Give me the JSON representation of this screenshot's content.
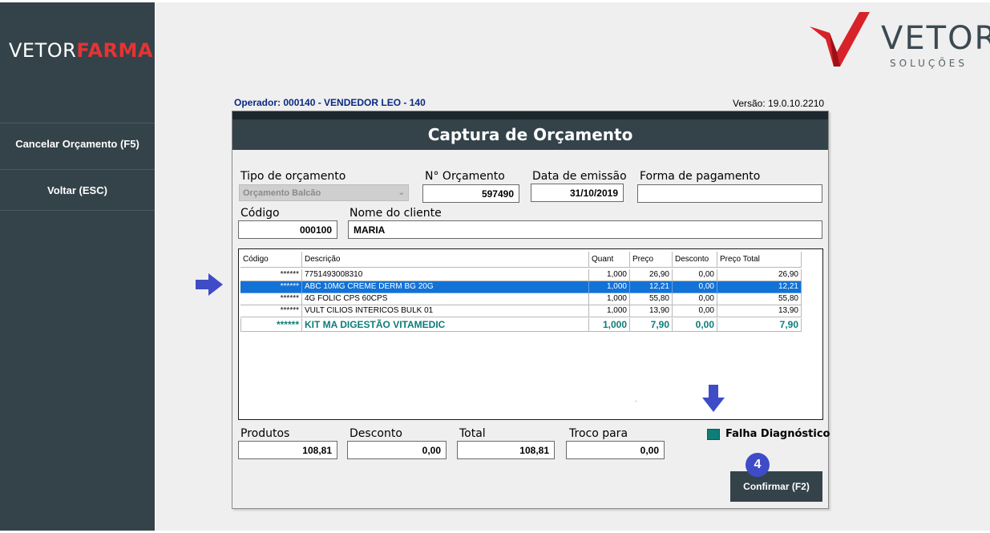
{
  "sidebar": {
    "brand_part1": "VETOR",
    "brand_part2": "FARMA",
    "items": [
      {
        "label": "Cancelar Orçamento (F5)"
      },
      {
        "label": "Voltar (ESC)"
      }
    ]
  },
  "logo": {
    "word": "VETOR",
    "sub": "SOLUÇÕES"
  },
  "header": {
    "operator": "Operador: 000140 - VENDEDOR LEO - 140",
    "version": "Versão: 19.0.10.2210"
  },
  "dialog": {
    "title": "Captura de Orçamento",
    "tipo_label": "Tipo de orçamento",
    "tipo_value": "Orçamento Balcão",
    "orcamento_label": "N° Orçamento",
    "orcamento_value": "597490",
    "data_label": "Data de emissão",
    "data_value": "31/10/2019",
    "pagamento_label": "Forma de pagamento",
    "pagamento_value": "",
    "codigo_label": "Código",
    "codigo_value": "000100",
    "cliente_label": "Nome do cliente",
    "cliente_value": "MARIA"
  },
  "table": {
    "headers": {
      "codigo": "Código",
      "descricao": "Descrição",
      "quant": "Quant",
      "preco": "Preço",
      "desconto": "Desconto",
      "total": "Preço Total"
    },
    "rows": [
      {
        "codigo": "******",
        "descricao": "7751493008310",
        "quant": "1,000",
        "preco": "26,90",
        "desconto": "0,00",
        "total": "26,90"
      },
      {
        "codigo": "******",
        "descricao": "ABC 10MG CREME DERM BG 20G",
        "quant": "1,000",
        "preco": "12,21",
        "desconto": "0,00",
        "total": "12,21"
      },
      {
        "codigo": "******",
        "descricao": "4G FOLIC CPS 60CPS",
        "quant": "1,000",
        "preco": "55,80",
        "desconto": "0,00",
        "total": "55,80"
      },
      {
        "codigo": "******",
        "descricao": "VULT CILIOS INTERICOS BULK 01",
        "quant": "1,000",
        "preco": "13,90",
        "desconto": "0,00",
        "total": "13,90"
      },
      {
        "codigo": "******",
        "descricao": "KIT MA DIGESTÃO VITAMEDIC",
        "quant": "1,000",
        "preco": "7,90",
        "desconto": "0,00",
        "total": "7,90"
      }
    ]
  },
  "totals": {
    "produtos_label": "Produtos",
    "produtos_value": "108,81",
    "desconto_label": "Desconto",
    "desconto_value": "0,00",
    "total_label": "Total",
    "total_value": "108,81",
    "troco_label": "Troco para",
    "troco_value": "0,00"
  },
  "fail": {
    "label": "Falha Diagnóstico",
    "color": "#0f7d78"
  },
  "badge": {
    "number": "4"
  },
  "confirm": {
    "label": "Confirmar (F2)"
  },
  "colors": {
    "sidebar": "#34434a",
    "accent_red": "#e53334",
    "selection": "#1272d6",
    "annotation": "#3f4cc7"
  }
}
